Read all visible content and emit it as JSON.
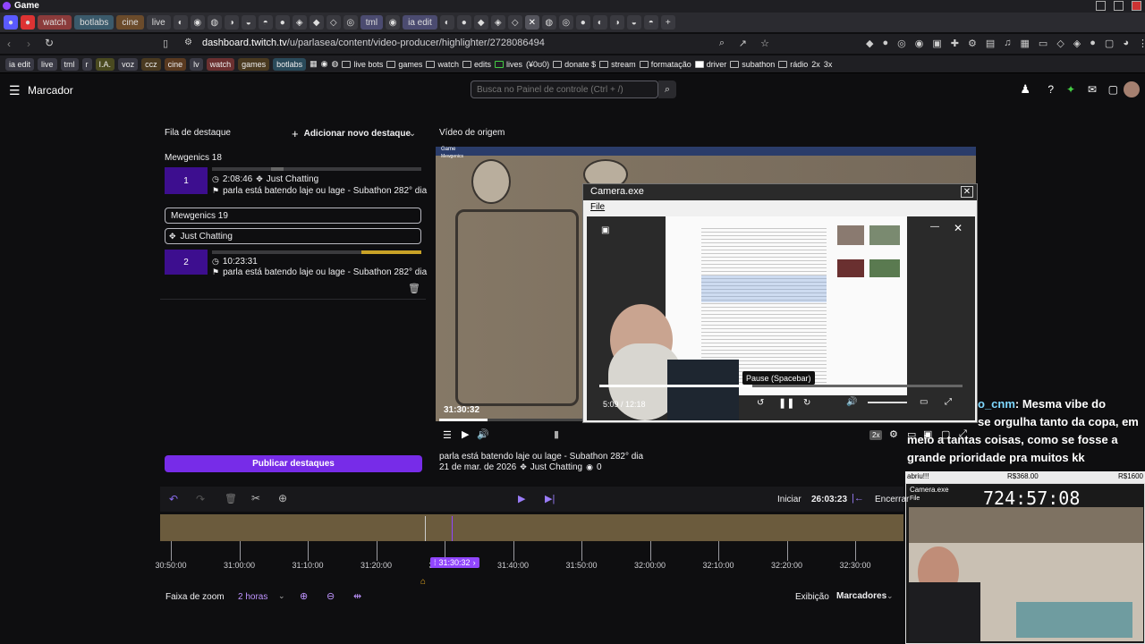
{
  "window": {
    "title": "Game"
  },
  "browser_tabs": [
    {
      "label": "watch"
    },
    {
      "label": "botlabs"
    },
    {
      "label": "cine"
    },
    {
      "label": "live"
    },
    {
      "label": "tml"
    },
    {
      "label": "ia edit"
    }
  ],
  "address_bar": {
    "url_host": "dashboard.twitch.tv",
    "url_path": "/u/parlasea/content/video-producer/highlighter/2728086494"
  },
  "bookmarks": {
    "tags": [
      "ia edit",
      "live",
      "tml",
      "r",
      "I.A.",
      "voz",
      "ccz",
      "cine",
      "lv",
      "watch",
      "games",
      "botlabs"
    ],
    "folders": [
      "live bots",
      "games",
      "watch",
      "edits",
      "lives",
      "(¥0ʊ0)",
      "donate $",
      "stream",
      "formatação",
      "driver",
      "subathon",
      "rádio",
      "2x",
      "3x"
    ]
  },
  "app_header": {
    "menu_label": "Marcador",
    "search_placeholder": "Busca no Painel de controle (Ctrl + /)"
  },
  "left_panel": {
    "title": "Fila de destaque",
    "add_button": "Adicionar novo destaque",
    "publish_button": "Publicar destaques",
    "groups": [
      {
        "name": "Mewgenics 18",
        "index": "1",
        "time": "2:08:46",
        "category": "Just Chatting",
        "title": "parla está batendo laje ou lage - Subathon 282° dia"
      },
      {
        "name": "Mewgenics 19",
        "category_field": "Just Chatting",
        "index": "2",
        "time": "10:23:31",
        "title": "parla está batendo laje ou lage - Subathon 282° dia"
      }
    ]
  },
  "right_panel": {
    "title": "Vídeo de origem",
    "video_time": "31:30:32",
    "video_title": "parla está batendo laje ou lage - Subathon 282° dia",
    "date": "21 de mar. de 2026",
    "category": "Just Chatting",
    "views": "0",
    "speed_badge": "2x",
    "source_topbar_label": "Game",
    "source_topbar_sub": "Mewgenics"
  },
  "camera_window": {
    "title": "Camera.exe",
    "menu_file": "File",
    "player_time": "5:09 / 12:18",
    "tooltip": "Pause (Spacebar)"
  },
  "chat": {
    "username": "o_cnm",
    "message": ": Mesma vibe do",
    "lines": [
      "se orgulha tanto da copa, em",
      "meio a tantas coisas, como se fosse a",
      "grande prioridade pra muitos kk"
    ]
  },
  "overlay": {
    "label_left": "abriu!!!",
    "price_mid": "R$368.00",
    "price_right": "R$1600",
    "cam_title": "Camera.exe",
    "cam_menu": "File",
    "timer": "724:57:08"
  },
  "timeline": {
    "start_label": "Iniciar",
    "start_time": "26:03:23",
    "end_label": "Encerrar",
    "playhead_time": "31:30:32",
    "ticks": [
      "30:50:00",
      "31:00:00",
      "31:10:00",
      "31:20:00",
      "31:30:00",
      "31:40:00",
      "31:50:00",
      "32:00:00",
      "32:10:00",
      "32:20:00",
      "32:30:00"
    ],
    "zoom_label": "Faixa de zoom",
    "zoom_value": "2 horas",
    "view_label": "Exibição",
    "view_value": "Marcadores"
  },
  "colors": {
    "accent": "#772ce8",
    "queue_index_bg": "#3d0e8f",
    "timeline_bar": "#6b5b3d",
    "progress_gold": "#c9a227"
  }
}
